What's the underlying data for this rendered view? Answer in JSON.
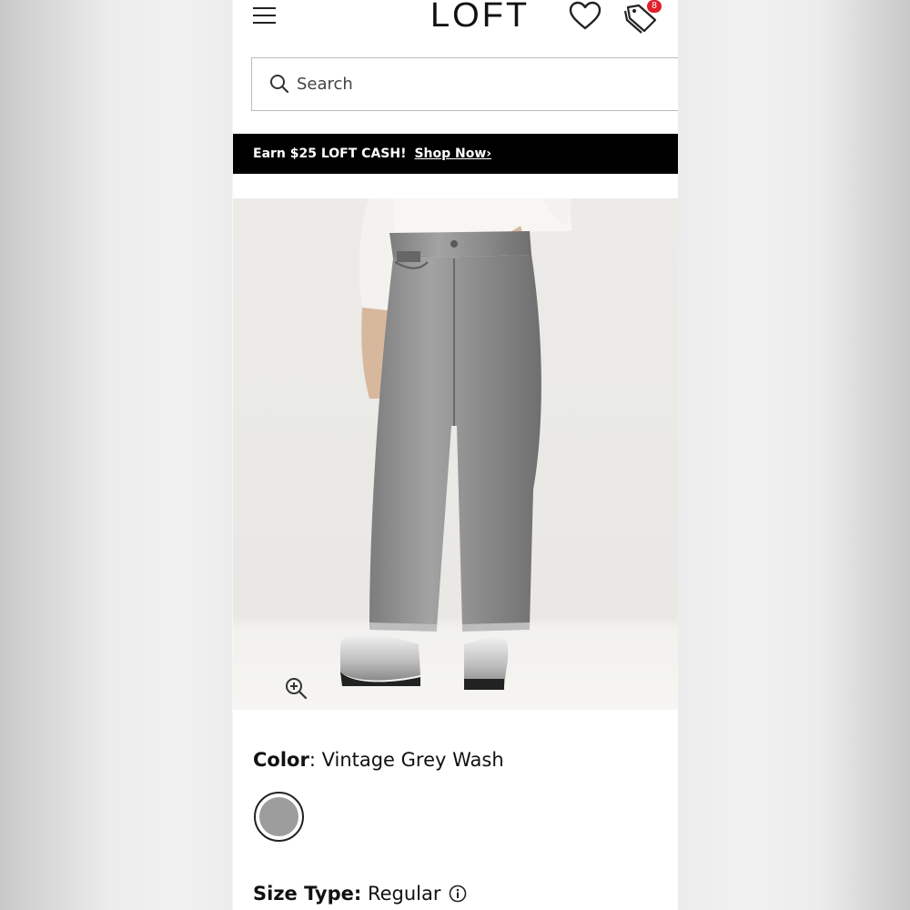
{
  "header": {
    "logo": "LOFT",
    "cart_badge_count": "8"
  },
  "search": {
    "placeholder": "Search"
  },
  "promo": {
    "text": "Earn $25 LOFT CASH!",
    "link_label": "Shop Now›"
  },
  "product": {
    "image_alt": "Model wearing grey wash straight-leg jeans with a white sweater and silver loafers",
    "color_heading": "Color",
    "color_value": ": Vintage Grey Wash",
    "swatch_color": "#9d9d9d",
    "size_type_heading": "Size Type:",
    "size_type_value": " Regular"
  },
  "icons": {
    "menu": "hamburger-menu-icon",
    "wishlist": "heart-icon",
    "cart": "tag-icon",
    "search": "search-icon",
    "zoom": "zoom-in-icon",
    "info": "info-icon"
  }
}
